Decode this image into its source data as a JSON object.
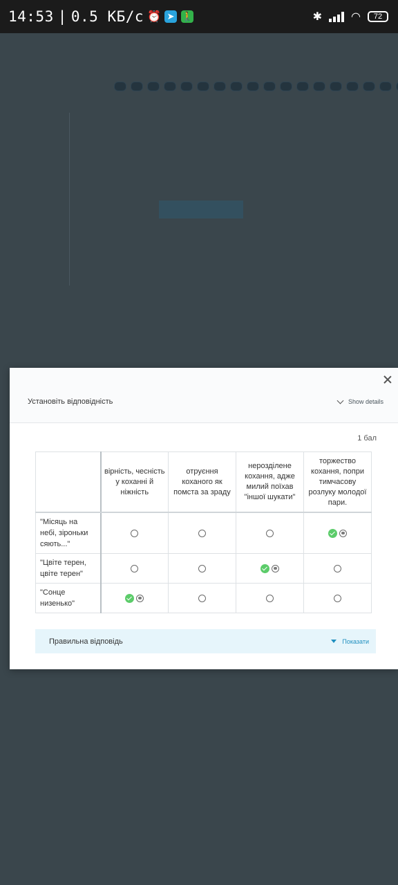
{
  "status_bar": {
    "time": "14:53",
    "network_speed": "0.5 КБ/с",
    "battery": "72",
    "icons": [
      "alarm-icon",
      "telegram-icon",
      "walk-icon",
      "bluetooth-icon",
      "signal-icon",
      "wifi-icon",
      "battery-icon"
    ]
  },
  "modal": {
    "title": "Установіть відповідність",
    "show_details": "Show details",
    "score": "1 бал",
    "columns": [
      "вірність, чесність у коханні й ніжність",
      "отруєння коханого як помста за зраду",
      "нерозділене кохання, адже милий поїхав \"іншої шукати\"",
      "торжество кохання, попри тимчасову розлуку молодої пари."
    ],
    "rows": [
      {
        "label": "\"Місяць на небі, зіроньки сяють...\"",
        "selected_column": 4,
        "correct": true
      },
      {
        "label": "\"Цвіте терен, цвіте терен\"",
        "selected_column": 3,
        "correct": true
      },
      {
        "label": "\"Сонце низенько\"",
        "selected_column": 1,
        "correct": true
      }
    ],
    "answer_bar": {
      "label": "Правильна відповідь",
      "toggle": "Показати"
    }
  },
  "colors": {
    "accent": "#1e8fbf",
    "check_green": "#5ccc6a",
    "overlay": "#3f4a4f"
  }
}
